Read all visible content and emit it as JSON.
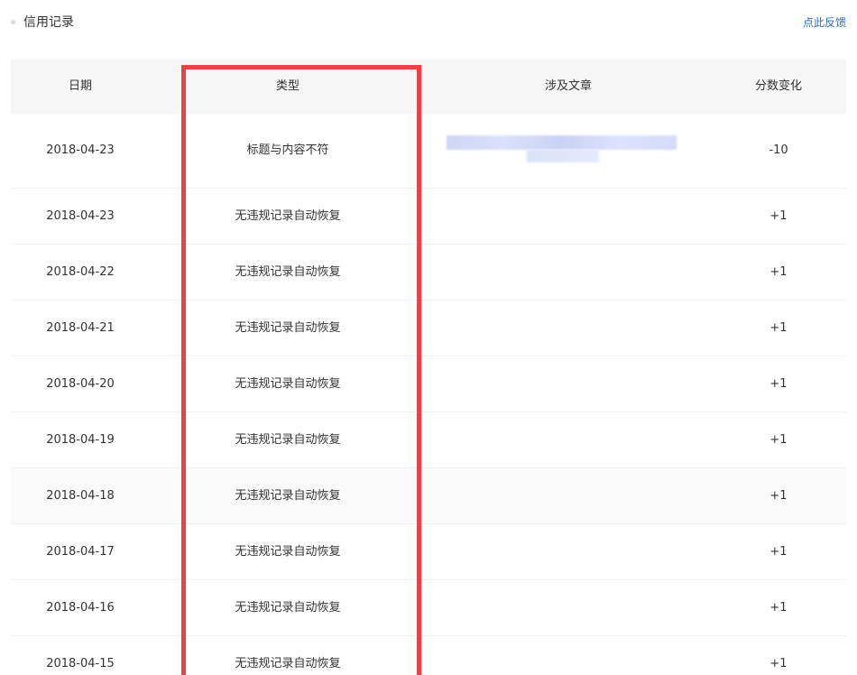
{
  "header": {
    "title": "信用记录",
    "feedback_link": "点此反馈"
  },
  "table": {
    "columns": [
      "日期",
      "类型",
      "涉及文章",
      "分数变化"
    ],
    "rows": [
      {
        "date": "2018-04-23",
        "type": "标题与内容不符",
        "article": "",
        "change": "-10"
      },
      {
        "date": "2018-04-23",
        "type": "无违规记录自动恢复",
        "article": "",
        "change": "+1"
      },
      {
        "date": "2018-04-22",
        "type": "无违规记录自动恢复",
        "article": "",
        "change": "+1"
      },
      {
        "date": "2018-04-21",
        "type": "无违规记录自动恢复",
        "article": "",
        "change": "+1"
      },
      {
        "date": "2018-04-20",
        "type": "无违规记录自动恢复",
        "article": "",
        "change": "+1"
      },
      {
        "date": "2018-04-19",
        "type": "无违规记录自动恢复",
        "article": "",
        "change": "+1"
      },
      {
        "date": "2018-04-18",
        "type": "无违规记录自动恢复",
        "article": "",
        "change": "+1"
      },
      {
        "date": "2018-04-17",
        "type": "无违规记录自动恢复",
        "article": "",
        "change": "+1"
      },
      {
        "date": "2018-04-16",
        "type": "无违规记录自动恢复",
        "article": "",
        "change": "+1"
      },
      {
        "date": "2018-04-15",
        "type": "无违规记录自动恢复",
        "article": "",
        "change": "+1"
      }
    ]
  },
  "colors": {
    "highlight_border": "#e84448",
    "link": "#2d6eb4",
    "header_bg": "#f6f6f6"
  }
}
